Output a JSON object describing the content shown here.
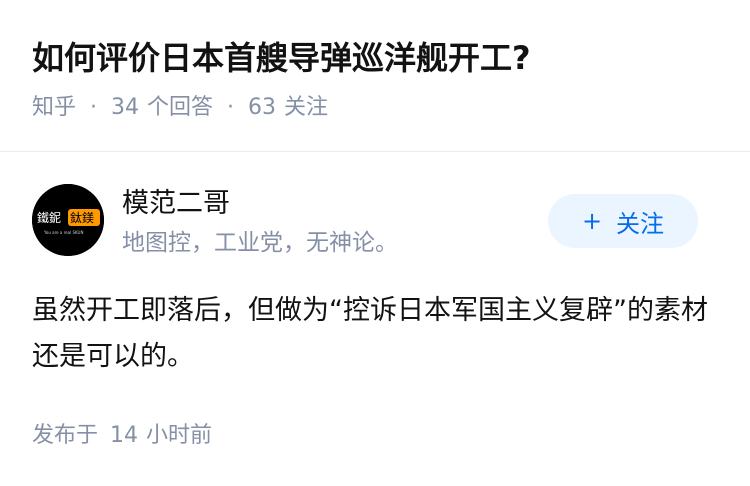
{
  "question": {
    "title": "如何评价日本首艘导弹巡洋舰开工?",
    "source": "知乎",
    "answers_count": "34",
    "answers_label": "个回答",
    "followers_count": "63",
    "followers_label": "关注",
    "separator": "·"
  },
  "author": {
    "avatar_text": "鐵鈮鈦鎂",
    "avatar_subtext": "You are a real SKUN",
    "name": "模范二哥",
    "bio": "地图控，工业党，无神论。",
    "follow_icon": "+",
    "follow_label": "关注"
  },
  "answer": {
    "content": "虽然开工即落后，但做为“控诉日本军国主义复辟”的素材还是可以的。",
    "time_prefix": "发布于",
    "time_value": "14",
    "time_unit": "小时前"
  },
  "colors": {
    "meta_gray": "#8590a6",
    "follow_blue": "#056de8",
    "follow_bg": "#ebf5ff",
    "avatar_orange": "#ff9900"
  }
}
